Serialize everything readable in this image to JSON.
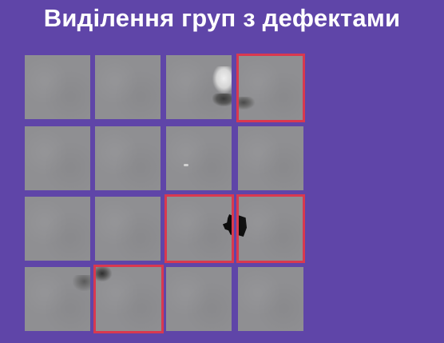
{
  "title": "Виділення груп з дефектами",
  "colors": {
    "background": "#5f45a8",
    "tile": "#8f8f92",
    "selection_border": "#d9394f",
    "title_text": "#ffffff"
  },
  "grid": {
    "rows": 4,
    "cols": 4,
    "selected_tiles": [
      {
        "row": 1,
        "col": 4
      },
      {
        "row": 3,
        "col": 3
      },
      {
        "row": 3,
        "col": 4
      },
      {
        "row": 4,
        "col": 2
      }
    ]
  }
}
